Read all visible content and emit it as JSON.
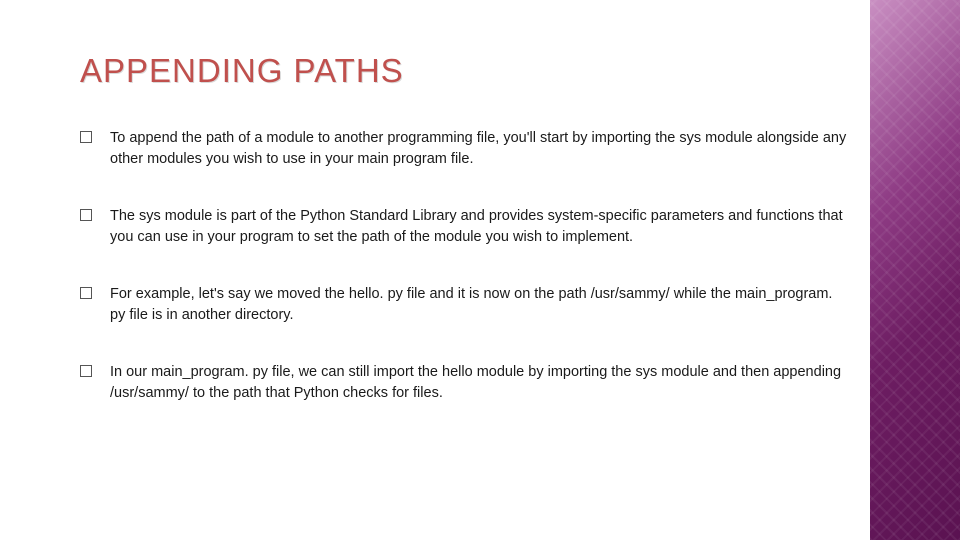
{
  "slide": {
    "title": "APPENDING PATHS",
    "bullets": [
      "To append the path of a module to another programming file, you'll start by importing the sys module alongside any other modules you wish to use in your main program file.",
      "The sys module is part of the Python Standard Library and provides system-specific parameters and functions that you can use in your program to set the path of the module you wish to implement.",
      "For example, let's say we moved the hello. py file and it is now on the path /usr/sammy/ while the main_program. py file is in another directory.",
      "In our main_program. py file, we can still import the hello module by importing the sys module and then appending /usr/sammy/ to the path that Python checks for files."
    ]
  }
}
